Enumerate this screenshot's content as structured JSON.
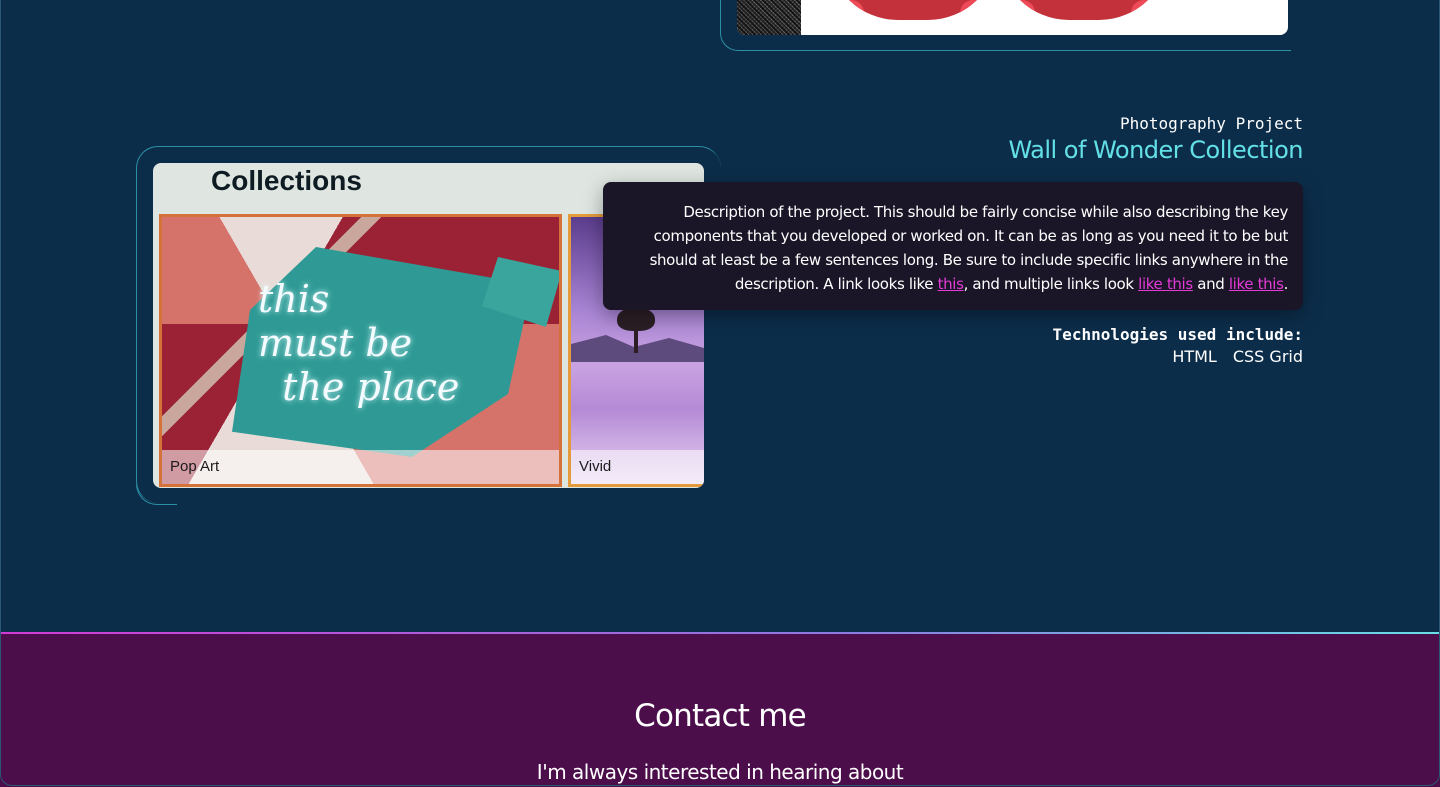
{
  "project": {
    "eyebrow": "Photography Project",
    "title": "Wall of Wonder Collection",
    "description": {
      "intro": "Description of the project. This should be fairly concise while also describing the key components that you developed or worked on. It can be as long as you need it to be but should at least be a few sentences long. Be sure to include specific links anywhere in the description. A link looks like ",
      "link1": "this",
      "mid": ", and multiple links look ",
      "link2": "like this",
      "and": " and ",
      "link3": "like this",
      "end": "."
    },
    "tech_label": "Technologies used include:",
    "technologies": [
      "HTML",
      "CSS Grid"
    ],
    "screenshot": {
      "heading": "Collections",
      "tiles": [
        {
          "caption": "Pop Art",
          "neon_text": "this\nmust be\n  the place"
        },
        {
          "caption": "Vivid"
        }
      ]
    }
  },
  "contact": {
    "title": "Contact me",
    "subtitle": "I'm always interested in hearing about"
  },
  "colors": {
    "background": "#0c2d4a",
    "accent_title": "#63e0e6",
    "link": "#e33ad7",
    "description_bg": "#1a1627",
    "contact_bg": "#4c0d4b"
  }
}
